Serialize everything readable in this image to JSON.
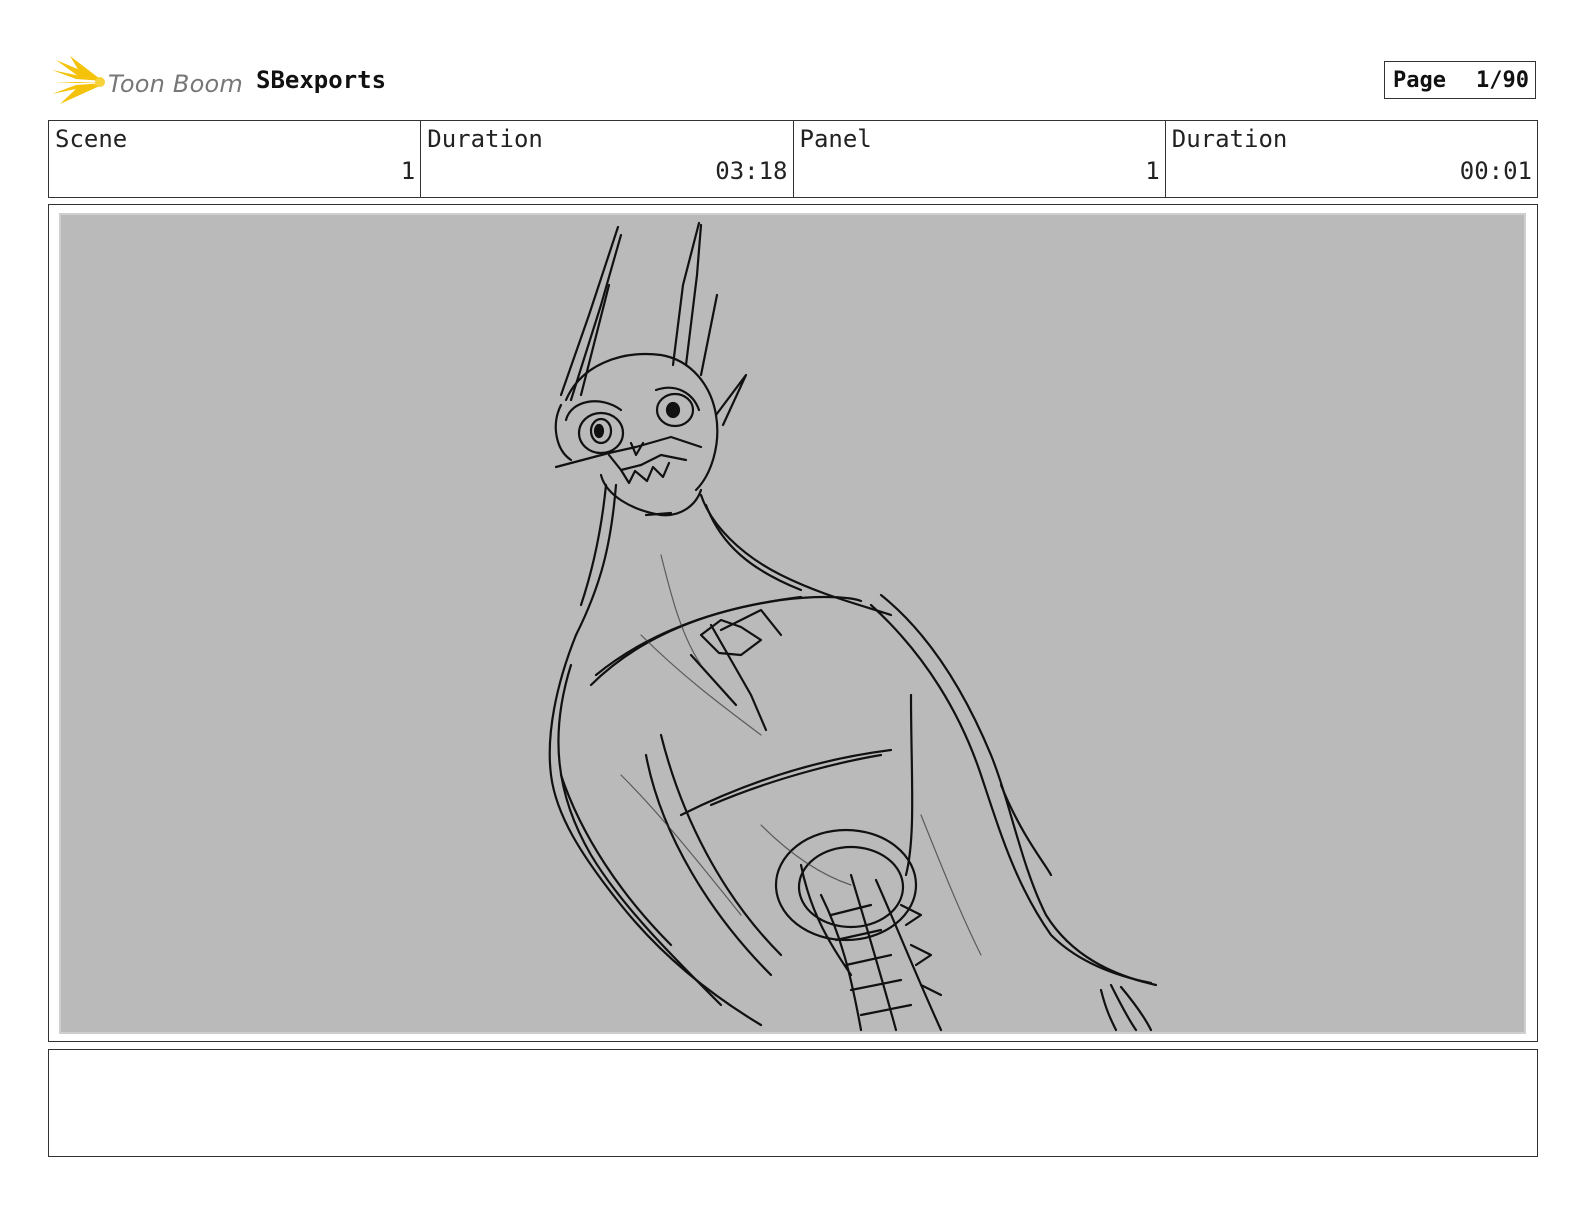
{
  "header": {
    "brand": "Toon Boom",
    "project": "SBexports",
    "page_label": "Page",
    "page_value": "1/90"
  },
  "info": {
    "scene_label": "Scene",
    "scene_value": "1",
    "scene_duration_label": "Duration",
    "scene_duration_value": "03:18",
    "panel_label": "Panel",
    "panel_value": "1",
    "panel_duration_label": "Duration",
    "panel_duration_value": "00:01"
  },
  "panel": {
    "background_color": "#bababa",
    "sketch_color": "#111111"
  },
  "notes": {
    "text": ""
  }
}
